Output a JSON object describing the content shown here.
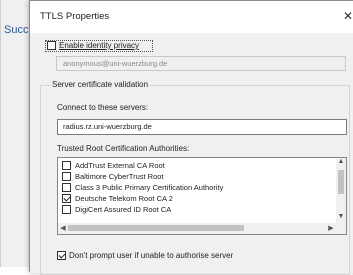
{
  "background": {
    "partial_text": "Succ"
  },
  "dialog": {
    "title": "TTLS Properties",
    "close_glyph": "✕",
    "enable_identity_privacy": {
      "label": "Enable identity privacy",
      "checked": false
    },
    "anonymous_identity": "anonymous@uni-wuerzburg.de",
    "server_validation": {
      "group_title": "Server certificate validation",
      "connect_label": "Connect to these servers:",
      "servers_value": "radius.rz.uni-wuerzburg.de",
      "trusted_ca_label": "Trusted Root Certification Authorities:",
      "ca_list": [
        {
          "label": "AddTrust External CA Root",
          "checked": false
        },
        {
          "label": "Baltimore CyberTrust Root",
          "checked": false
        },
        {
          "label": "Class 3 Public Primary Certification Authority",
          "checked": false
        },
        {
          "label": "Deutsche Telekom Root CA 2",
          "checked": true
        },
        {
          "label": "DigiCert Assured ID Root CA",
          "checked": false
        }
      ],
      "dont_prompt": {
        "label": "Don't prompt user if unable to authorise server",
        "checked": true
      }
    }
  }
}
